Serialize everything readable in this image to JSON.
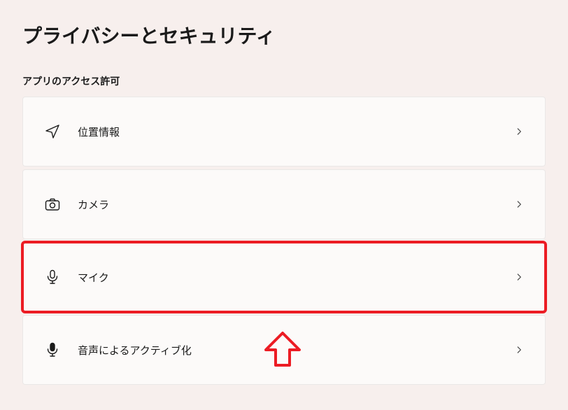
{
  "title": "プライバシーとセキュリティ",
  "section_label": "アプリのアクセス許可",
  "items": [
    {
      "label": "位置情報",
      "icon": "location",
      "highlighted": false
    },
    {
      "label": "カメラ",
      "icon": "camera",
      "highlighted": false
    },
    {
      "label": "マイク",
      "icon": "microphone",
      "highlighted": true
    },
    {
      "label": "音声によるアクティブ化",
      "icon": "voice-activation",
      "highlighted": false
    }
  ],
  "annotation": {
    "type": "arrow",
    "target_index": 2,
    "color": "#ec1c24"
  }
}
